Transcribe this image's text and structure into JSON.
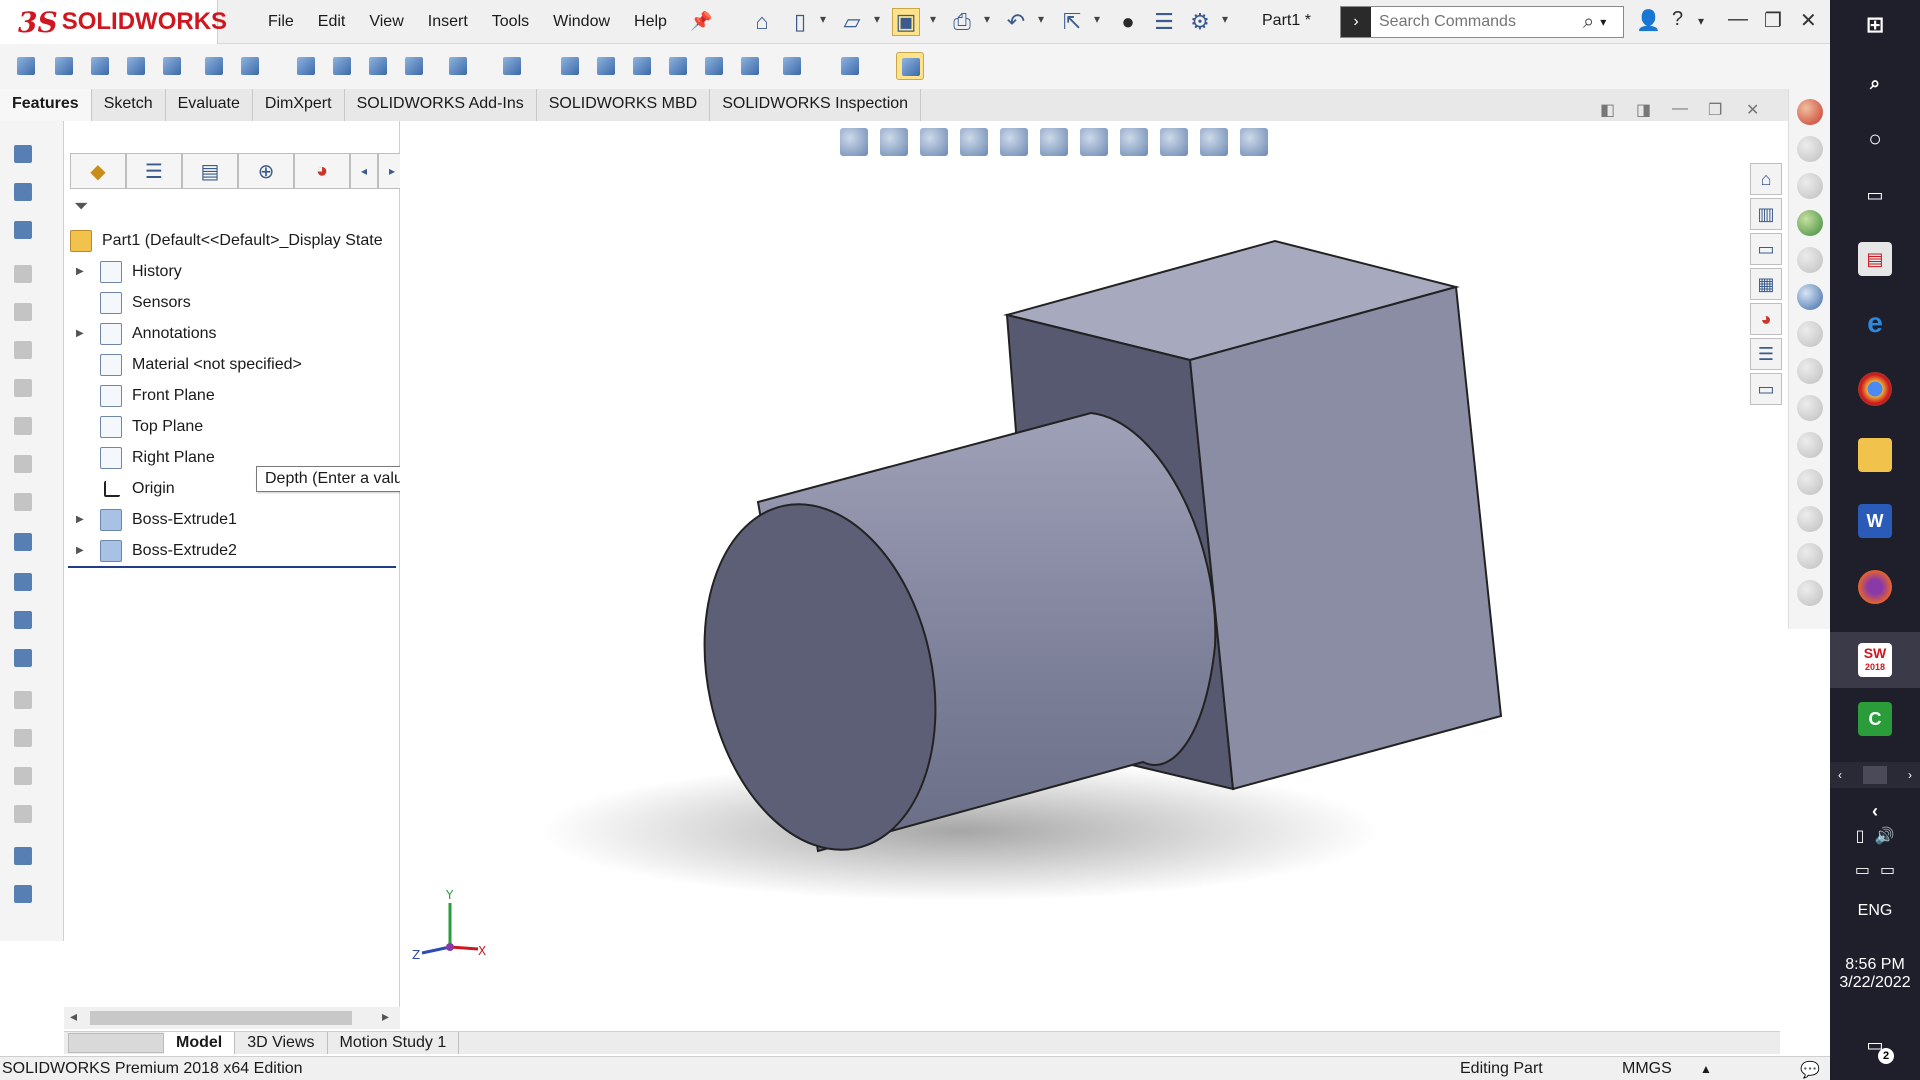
{
  "app": {
    "logo_ds": "3S",
    "logo_name": "SOLIDWORKS",
    "document_title": "Part1 *"
  },
  "menu": [
    "File",
    "Edit",
    "View",
    "Insert",
    "Tools",
    "Window",
    "Help"
  ],
  "search": {
    "placeholder": "Search Commands"
  },
  "tabs": [
    "Features",
    "Sketch",
    "Evaluate",
    "DimXpert",
    "SOLIDWORKS Add-Ins",
    "SOLIDWORKS MBD",
    "SOLIDWORKS Inspection"
  ],
  "feature_tree": {
    "root": "Part1  (Default<<Default>_Display State",
    "items": [
      {
        "label": "History",
        "expandable": true,
        "icon": "history-icon"
      },
      {
        "label": "Sensors",
        "expandable": false,
        "icon": "sensors-icon"
      },
      {
        "label": "Annotations",
        "expandable": true,
        "icon": "annotations-icon"
      },
      {
        "label": "Material <not specified>",
        "expandable": false,
        "icon": "material-icon"
      },
      {
        "label": "Front Plane",
        "expandable": false,
        "icon": "plane-icon"
      },
      {
        "label": "Top Plane",
        "expandable": false,
        "icon": "plane-icon"
      },
      {
        "label": "Right Plane",
        "expandable": false,
        "icon": "plane-icon"
      },
      {
        "label": "Origin",
        "expandable": false,
        "icon": "origin-icon"
      },
      {
        "label": "Boss-Extrude1",
        "expandable": true,
        "icon": "extrude-icon"
      },
      {
        "label": "Boss-Extrude2",
        "expandable": true,
        "icon": "extrude-icon"
      }
    ]
  },
  "tooltip": "Depth (Enter a value or start with = to create an equation)",
  "triad": {
    "y": "Y",
    "z": "Z",
    "x": "X"
  },
  "model_tabs": [
    "Model",
    "3D Views",
    "Motion Study 1"
  ],
  "status": {
    "edition": "SOLIDWORKS Premium 2018 x64 Edition",
    "mode": "Editing Part",
    "units": "MMGS"
  },
  "taskbar": {
    "lang": "ENG",
    "time": "8:56 PM",
    "date": "3/22/2022",
    "notif_count": "2",
    "sw_badge": "2018"
  },
  "colors": {
    "brand_red": "#d0161f",
    "model_face_light": "#a8aac0",
    "model_face_mid": "#8c8ea6",
    "model_face_dark": "#53566d"
  }
}
